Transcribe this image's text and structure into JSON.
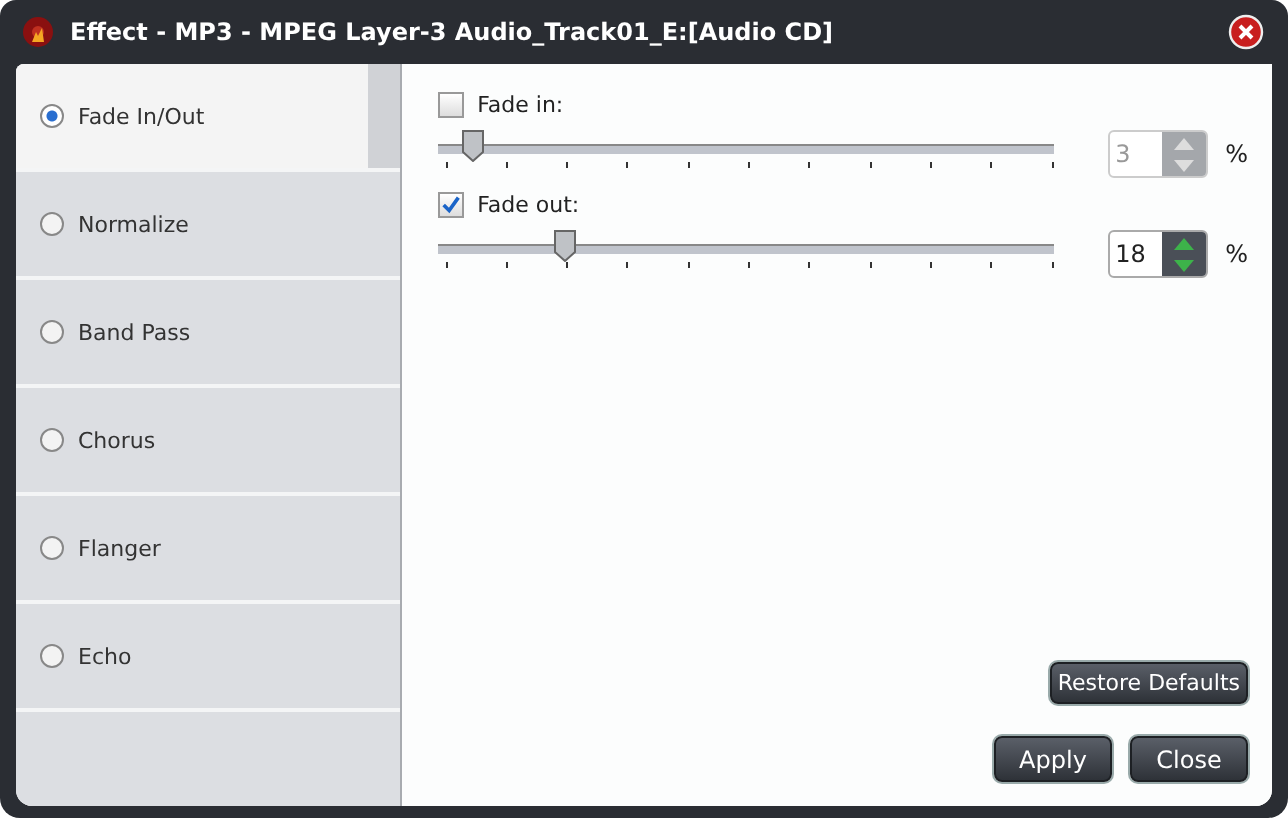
{
  "window": {
    "title": "Effect - MP3 - MPEG Layer-3 Audio_Track01_E:[Audio CD]"
  },
  "sidebar": {
    "items": [
      {
        "label": "Fade In/Out",
        "selected": true
      },
      {
        "label": "Normalize",
        "selected": false
      },
      {
        "label": "Band Pass",
        "selected": false
      },
      {
        "label": "Chorus",
        "selected": false
      },
      {
        "label": "Flanger",
        "selected": false
      },
      {
        "label": "Echo",
        "selected": false
      }
    ]
  },
  "fades": [
    {
      "label": "Fade in:",
      "checked": false,
      "level": 0.04,
      "value": "3",
      "unit": "%"
    },
    {
      "label": "Fade out:",
      "checked": true,
      "level": 0.19,
      "value": "18",
      "unit": "%"
    }
  ],
  "buttons": {
    "restore": "Restore Defaults",
    "apply": "Apply",
    "close": "Close"
  }
}
